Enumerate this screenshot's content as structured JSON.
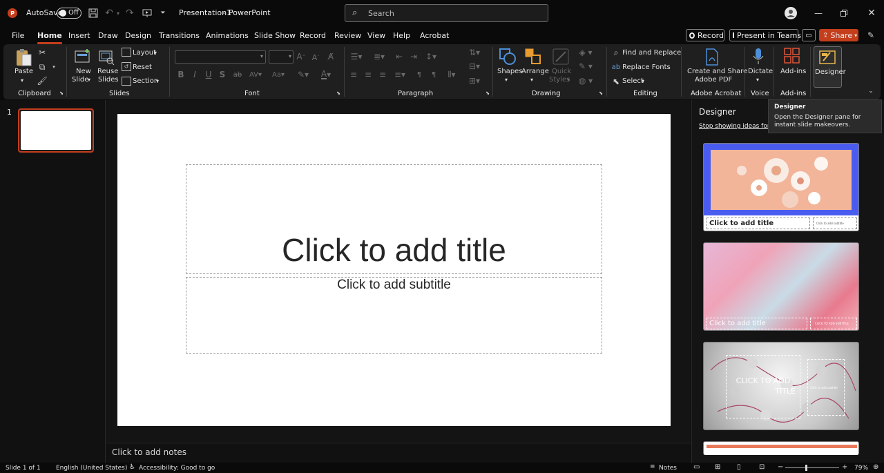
{
  "titlebar": {
    "autosave_label": "AutoSave",
    "autosave_state": "Off",
    "document_title": "Presentation1",
    "title_separator": "-",
    "app_name": "PowerPoint",
    "search_placeholder": "Search"
  },
  "menu": {
    "tabs": [
      "File",
      "Home",
      "Insert",
      "Draw",
      "Design",
      "Transitions",
      "Animations",
      "Slide Show",
      "Record",
      "Review",
      "View",
      "Help",
      "Acrobat"
    ],
    "active": "Home",
    "record_button": "Record",
    "present_teams_button": "Present in Teams",
    "share_button": "Share"
  },
  "ribbon": {
    "clipboard": {
      "paste": "Paste",
      "group": "Clipboard"
    },
    "slides": {
      "new_slide_1": "New",
      "new_slide_2": "Slide",
      "reuse_1": "Reuse",
      "reuse_2": "Slides",
      "layout": "Layout",
      "reset": "Reset",
      "section": "Section",
      "group": "Slides"
    },
    "font": {
      "group": "Font"
    },
    "paragraph": {
      "group": "Paragraph"
    },
    "drawing": {
      "shapes": "Shapes",
      "arrange": "Arrange",
      "quick_1": "Quick",
      "quick_2": "Styles",
      "group": "Drawing"
    },
    "editing": {
      "find_replace": "Find and Replace",
      "replace_fonts": "Replace Fonts",
      "select": "Select",
      "group": "Editing"
    },
    "acrobat": {
      "label_1": "Create and Share",
      "label_2": "Adobe PDF",
      "group": "Adobe Acrobat"
    },
    "voice": {
      "dictate": "Dictate",
      "group": "Voice"
    },
    "addins": {
      "addins": "Add-ins",
      "group": "Add-ins"
    },
    "designer": {
      "designer": "Designer"
    }
  },
  "thumbnails": {
    "slide_number": "1"
  },
  "slide": {
    "title_placeholder": "Click to add title",
    "subtitle_placeholder": "Click to add subtitle"
  },
  "notes": {
    "placeholder": "Click to add notes"
  },
  "designer_pane": {
    "title": "Designer",
    "stop_link": "Stop showing ideas for n",
    "ideas": [
      {
        "title": "Click to add title",
        "subtitle": "Click to add subtitle"
      },
      {
        "title": "Click to add title",
        "subtitle": "CLICK TO ADD SUBTITLE"
      },
      {
        "title_line1": "CLICK TO ADD",
        "title_line2": "TITLE",
        "subtitle": "Click to add subtitle"
      }
    ]
  },
  "tooltip": {
    "title": "Designer",
    "line1": "Open the Designer pane for",
    "line2": "instant slide makeovers."
  },
  "status": {
    "slide_counter": "Slide 1 of 1",
    "language": "English (United States)",
    "accessibility": "Accessibility: Good to go",
    "notes": "Notes",
    "zoom": "79%"
  },
  "colors": {
    "accent": "#c43e1c",
    "share": "#c43e1c",
    "designer_blue": "#4a5cf0"
  }
}
